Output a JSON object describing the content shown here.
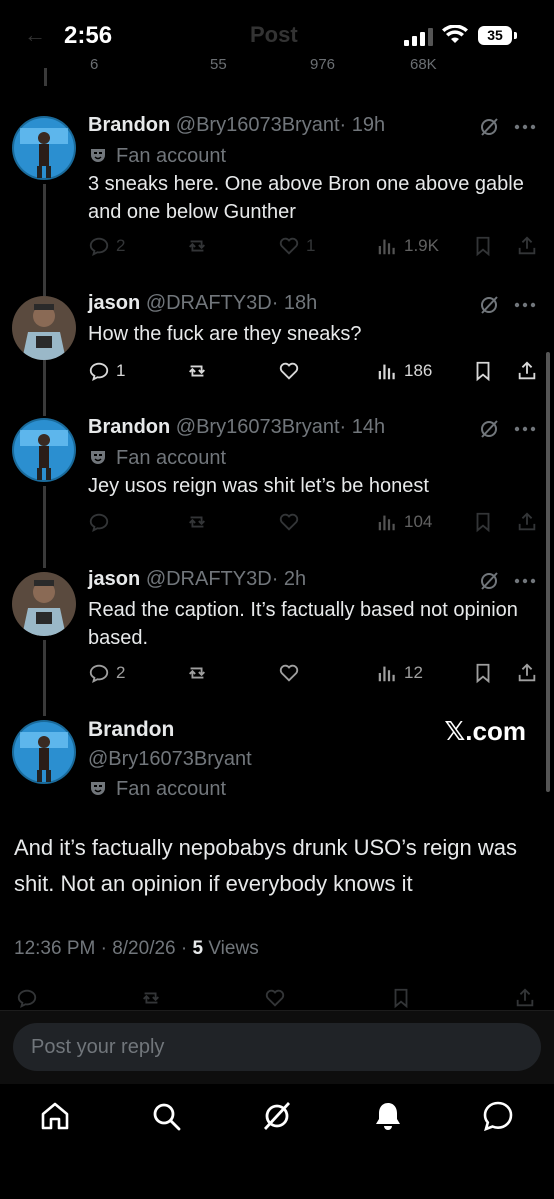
{
  "status_bar": {
    "time": "2:56",
    "battery": "35",
    "ghost_title": "Post"
  },
  "ghost_actions": {
    "replies": "6",
    "reposts": "55",
    "likes": "976",
    "views": "68K"
  },
  "tweets": [
    {
      "name": "Brandon",
      "handle": "@Bry16073Bryant",
      "time": "· 19h",
      "badge": "Fan account",
      "text": "3 sneaks here. One above Bron one above gable and one below Gunther",
      "replies": "2",
      "reposts": "",
      "likes": "1",
      "views": "1.9K"
    },
    {
      "name": "jason",
      "handle": "@DRAFTY3D",
      "time": "· 18h",
      "badge": "",
      "text": "How the fuck are they sneaks?",
      "replies": "1",
      "reposts": "",
      "likes": "",
      "views": "186"
    },
    {
      "name": "Brandon",
      "handle": "@Bry16073Bryant",
      "time": "· 14h",
      "badge": "Fan account",
      "text": "Jey usos reign was shit let’s be honest",
      "replies": "",
      "reposts": "",
      "likes": "",
      "views": "104"
    },
    {
      "name": "jason",
      "handle": "@DRAFTY3D",
      "time": "· 2h",
      "badge": "",
      "text": "Read the caption. It’s factually based not opinion based.",
      "replies": "2",
      "reposts": "",
      "likes": "",
      "views": "12"
    }
  ],
  "main_post": {
    "name": "Brandon",
    "handle": "@Bry16073Bryant",
    "badge": "Fan account",
    "watermark": "𝕏.com",
    "text": "And it’s factually nepobabys drunk USO’s reign was shit. Not an opinion if everybody knows it",
    "timestamp": "12:36 PM · 8/20/26 · ",
    "views_count": "5",
    "views_label": " Views"
  },
  "reply": {
    "placeholder": "Post your reply"
  },
  "tabs": [
    "home-icon",
    "search-icon",
    "grok-icon",
    "notifications-icon",
    "messages-icon"
  ],
  "colors": {
    "background": "#000000",
    "text": "#e7e9ea",
    "muted": "#71767b",
    "input": "#202327"
  }
}
